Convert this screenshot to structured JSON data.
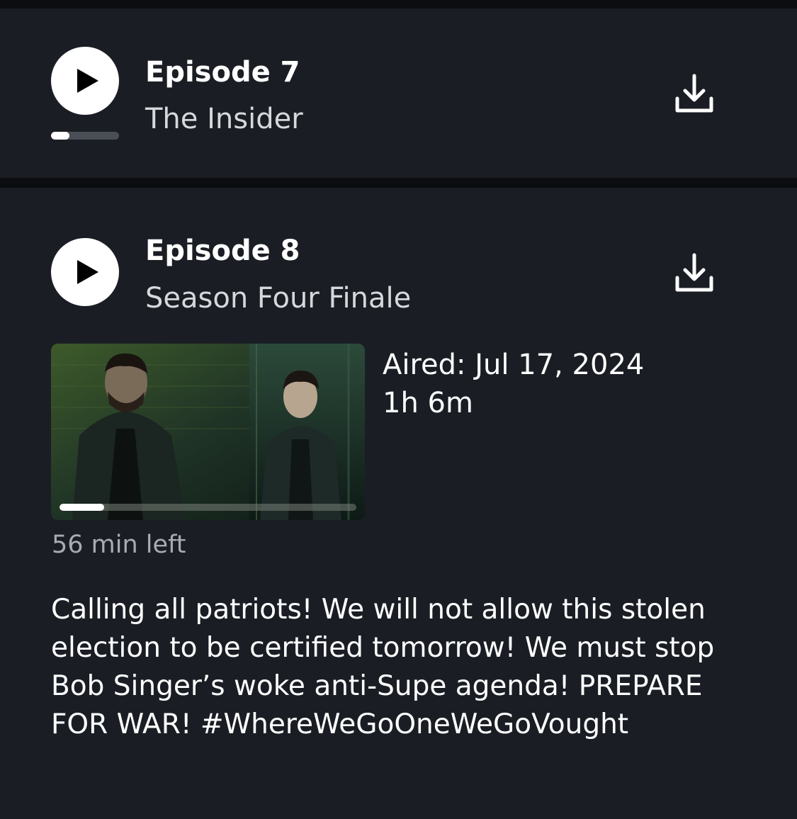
{
  "episodes": [
    {
      "number_label": "Episode 7",
      "title": "The Insider",
      "progress": 0.27
    },
    {
      "number_label": "Episode 8",
      "title": "Season Four Finale",
      "aired": "Aired: Jul 17, 2024",
      "duration": "1h 6m",
      "time_left": "56 min left",
      "thumbnail_progress": 0.15,
      "description": "Calling all patriots! We will not allow this stolen election to be certified tomorrow! We must stop Bob Singer’s woke anti-Supe agenda! PREPARE FOR WAR! #WhereWeGoOneWeGoVought"
    }
  ],
  "icons": {
    "play": "play-icon",
    "download": "download-icon"
  },
  "colors": {
    "background": "#1a1e24",
    "divider": "#0b0d10",
    "text_primary": "#ffffff",
    "text_secondary": "#a8acb1"
  }
}
